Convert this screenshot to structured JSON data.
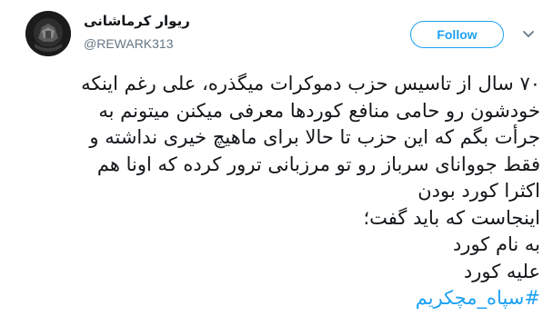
{
  "tweet": {
    "display_name": "ریوار کرماشانی",
    "handle": "@REWARK313",
    "follow_label": "Follow",
    "avatar_icon": "profile-avatar",
    "menu_icon": "chevron-down-icon",
    "accent_color": "#1da1f2",
    "text_lines": [
      "۷۰ سال از تاسیس حزب دموکرات میگذره،  علی رغم اینکه",
      "خودشون رو حامی منافع کوردها معرفی میکنن میتونم به",
      "جرأت بگم که این حزب تا حالا برای ماهیچ خیری نداشته و",
      "فقط جووانای سرباز رو تو مرزبانی ترور کرده که اونا هم",
      "اکثرا کورد بودن",
      "اینجاست که باید گفت؛",
      "به نام کورد",
      "علیه کورد"
    ],
    "hashtag": "#سپاه_مچکریم"
  }
}
